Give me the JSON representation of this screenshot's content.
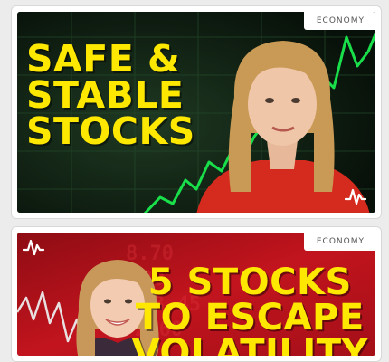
{
  "cards": [
    {
      "category": "ECONOMY",
      "headline_lines": [
        "SAFE &",
        "STABLE",
        "STOCKS"
      ],
      "logo_icon": "pulse-logo-icon",
      "accent_color": "#ffe800"
    },
    {
      "category": "ECONOMY",
      "headline_lines": [
        "5 STOCKS",
        "TO ESCAPE",
        "VOLATILITY"
      ],
      "logo_icon": "pulse-logo-icon",
      "accent_color": "#ffe800"
    }
  ]
}
